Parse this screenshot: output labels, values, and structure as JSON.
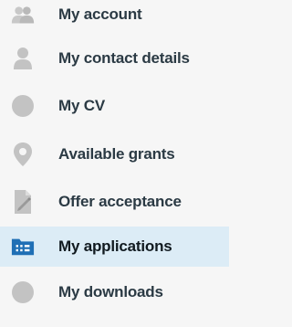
{
  "nav": {
    "items": [
      {
        "label": "My account",
        "icon": "users-icon"
      },
      {
        "label": "My contact details",
        "icon": "person-icon"
      },
      {
        "label": "My CV",
        "icon": "document-circle-icon"
      },
      {
        "label": "Available grants",
        "icon": "map-pin-icon"
      },
      {
        "label": "Offer acceptance",
        "icon": "signed-document-icon"
      },
      {
        "label": "My applications",
        "icon": "applications-folder-icon",
        "active": true
      },
      {
        "label": "My downloads",
        "icon": "downloads-circle-icon"
      }
    ]
  },
  "colors": {
    "icon_inactive": "#c3c3c3",
    "icon_active": "#1f6fb5",
    "active_background": "#dcecf6",
    "label_text": "#2b3a44"
  }
}
